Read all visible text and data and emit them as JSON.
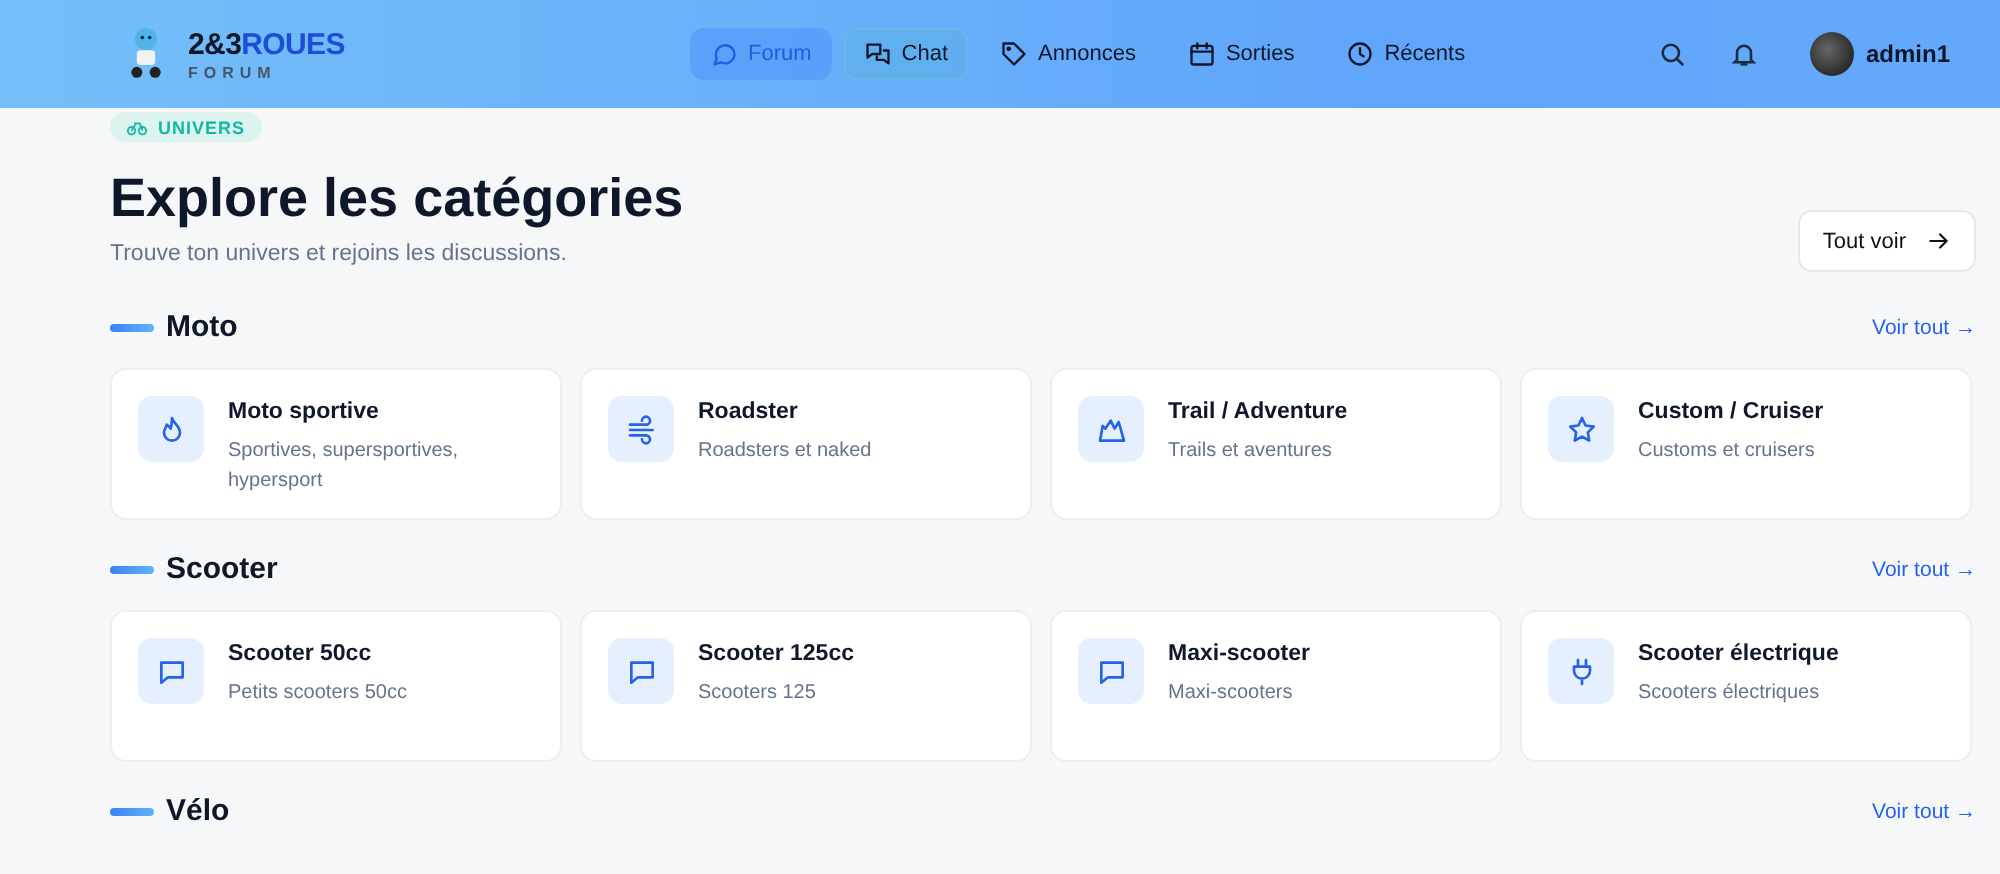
{
  "brand": {
    "name_part1": "2&3",
    "name_part2": "ROUES",
    "subtitle": "FORUM"
  },
  "nav": [
    {
      "label": "Forum",
      "selected": true,
      "hovered": false
    },
    {
      "label": "Chat",
      "selected": false,
      "hovered": true
    },
    {
      "label": "Annonces",
      "selected": false,
      "hovered": false
    },
    {
      "label": "Sorties",
      "selected": false,
      "hovered": false
    },
    {
      "label": "Récents",
      "selected": false,
      "hovered": false
    }
  ],
  "user": {
    "name": "admin1"
  },
  "badge": "UNIVERS",
  "title": "Explore les catégories",
  "subtitle": "Trouve ton univers et rejoins les discussions.",
  "see_all_button": "Tout voir",
  "sections": [
    {
      "title": "Moto",
      "link": "Voir tout →",
      "cards": [
        {
          "kind": "flame",
          "title": "Moto sportive",
          "description": "Sportives, supersportives, hypersport"
        },
        {
          "kind": "wind",
          "title": "Roadster",
          "description": "Roadsters et naked"
        },
        {
          "kind": "mountain",
          "title": "Trail / Adventure",
          "description": "Trails et aventures"
        },
        {
          "kind": "star",
          "title": "Custom / Cruiser",
          "description": "Customs et cruisers"
        }
      ]
    },
    {
      "title": "Scooter",
      "link": "Voir tout →",
      "cards": [
        {
          "kind": "chat",
          "title": "Scooter 50cc",
          "description": "Petits scooters 50cc"
        },
        {
          "kind": "chat",
          "title": "Scooter 125cc",
          "description": "Scooters 125"
        },
        {
          "kind": "chat",
          "title": "Maxi-scooter",
          "description": "Maxi-scooters"
        },
        {
          "kind": "plug",
          "title": "Scooter électrique",
          "description": "Scooters électriques"
        }
      ]
    },
    {
      "title": "Vélo",
      "link": "Voir tout →"
    }
  ]
}
